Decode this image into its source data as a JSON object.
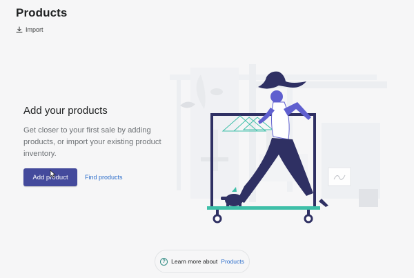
{
  "header": {
    "title": "Products",
    "import_label": "Import"
  },
  "empty_state": {
    "heading": "Add your products",
    "description": "Get closer to your first sale by adding products, or import your existing product inventory.",
    "primary_action": "Add product",
    "secondary_action": "Find products"
  },
  "footer_help": {
    "prefix": "Learn more about",
    "link": "Products"
  },
  "colors": {
    "primary_button": "#444a9c",
    "link": "#2c6ecb",
    "accent_teal": "#3ebfa8",
    "figure_navy": "#2f3063",
    "figure_purple": "#5f5fcf"
  }
}
